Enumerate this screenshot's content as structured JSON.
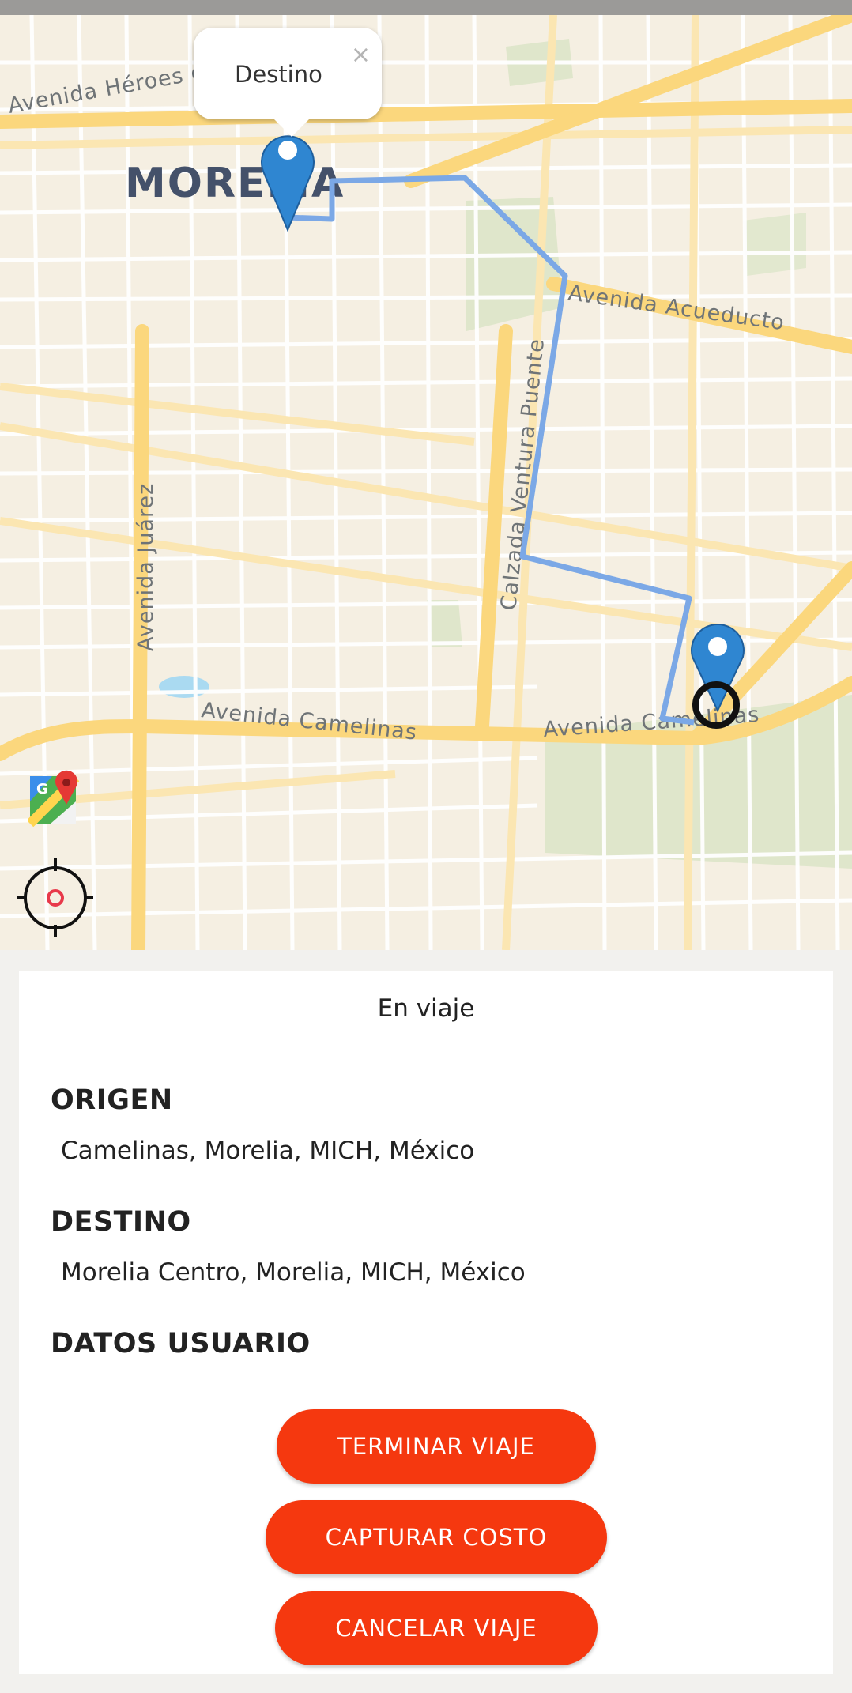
{
  "map": {
    "city_label": "MORELIA",
    "street_labels": {
      "heroes": "Avenida Héroes d",
      "acueducto": "Avenida Acueducto",
      "ventura_puente": "Calzada Ventura Puente",
      "juarez": "Avenida Juárez",
      "camelinas_west": "Avenida Camelinas",
      "camelinas_east": "Avenida Camelinas"
    },
    "popup": {
      "text": "Destino",
      "close_symbol": "×"
    },
    "destination_marker_icon": "map-pin-icon",
    "origin_marker_icon": "map-pin-icon",
    "current_location_icon": "location-ring-icon",
    "maps_app_icon": "google-maps-icon",
    "locate_icon": "crosshair-icon",
    "route_color": "#7ba8e6"
  },
  "trip": {
    "status": "En viaje",
    "origin_heading": "ORIGEN",
    "origin_value": "Camelinas, Morelia, MICH, México",
    "destination_heading": "DESTINO",
    "destination_value": "Morelia Centro, Morelia, MICH, México",
    "user_heading": "DATOS USUARIO"
  },
  "actions": {
    "finish_label": "TERMINAR VIAJE",
    "capture_cost_label": "CAPTURAR COSTO",
    "cancel_label": "CANCELAR VIAJE"
  },
  "colors": {
    "accent": "#f5380f",
    "map_background": "#f5efe2",
    "road_major": "#fbd77d",
    "pin": "#2f86d1"
  }
}
